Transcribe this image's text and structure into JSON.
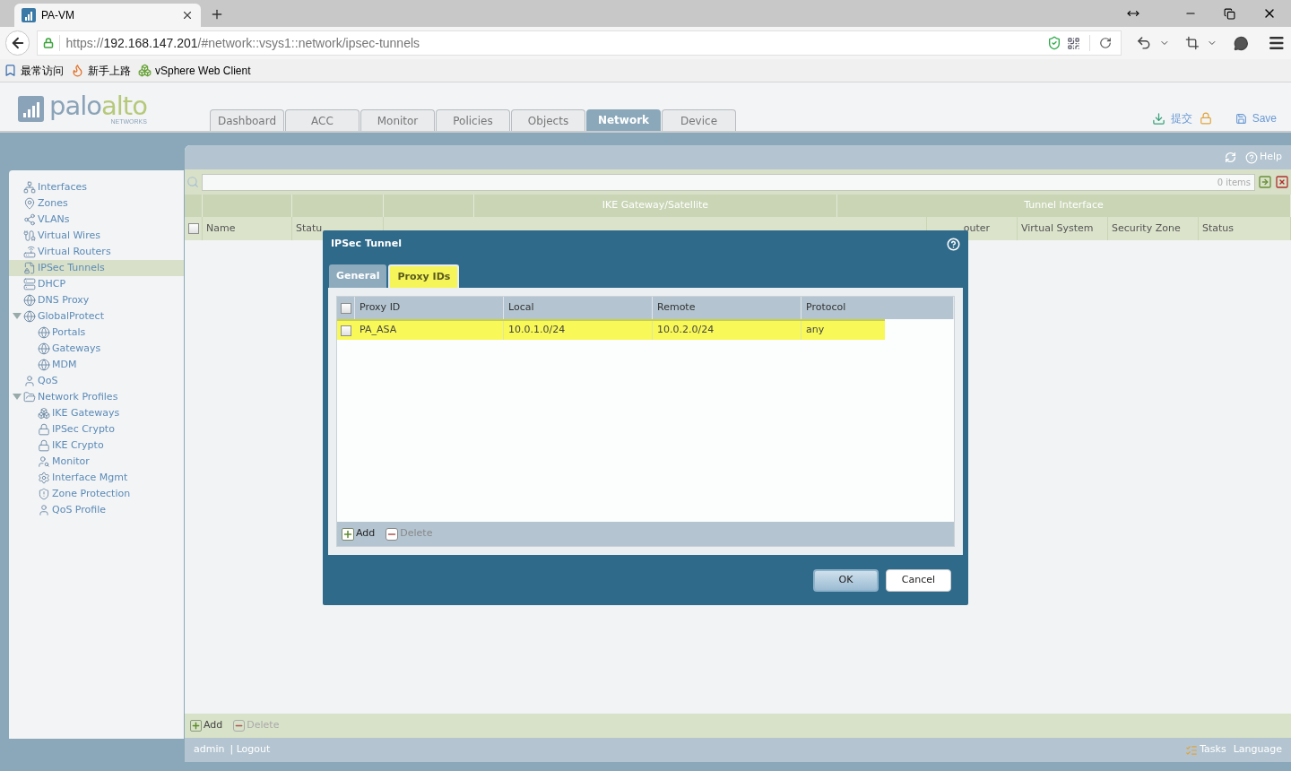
{
  "browser": {
    "tab_title": "PA-VM",
    "url_scheme": "https://",
    "url_host": "192.168.147.201",
    "url_path": "/#network::vsys1::network/ipsec-tunnels",
    "bookmarks": [
      "最常访问",
      "新手上路",
      "vSphere Web Client"
    ]
  },
  "app": {
    "logo": {
      "part1": "palo",
      "part2": "alto",
      "tagline": "NETWORKS"
    },
    "nav_tabs": [
      {
        "label": "Dashboard",
        "selected": false
      },
      {
        "label": "ACC",
        "selected": false
      },
      {
        "label": "Monitor",
        "selected": false
      },
      {
        "label": "Policies",
        "selected": false
      },
      {
        "label": "Objects",
        "selected": false
      },
      {
        "label": "Network",
        "selected": true
      },
      {
        "label": "Device",
        "selected": false
      }
    ],
    "commit": "提交",
    "save": "Save"
  },
  "sidebar": {
    "items": [
      {
        "label": "Interfaces",
        "selected": false
      },
      {
        "label": "Zones",
        "selected": false
      },
      {
        "label": "VLANs",
        "selected": false
      },
      {
        "label": "Virtual Wires",
        "selected": false
      },
      {
        "label": "Virtual Routers",
        "selected": false
      },
      {
        "label": "IPSec Tunnels",
        "selected": true
      },
      {
        "label": "DHCP",
        "selected": false
      },
      {
        "label": "DNS Proxy",
        "selected": false
      },
      {
        "label": "GlobalProtect",
        "selected": false,
        "expanded": true,
        "children": [
          {
            "label": "Portals",
            "selected": false
          },
          {
            "label": "Gateways",
            "selected": false
          },
          {
            "label": "MDM",
            "selected": false
          }
        ]
      },
      {
        "label": "QoS",
        "selected": false
      },
      {
        "label": "Network Profiles",
        "selected": false,
        "expanded": true,
        "children": [
          {
            "label": "IKE Gateways",
            "selected": false
          },
          {
            "label": "IPSec Crypto",
            "selected": false
          },
          {
            "label": "IKE Crypto",
            "selected": false
          },
          {
            "label": "Monitor",
            "selected": false
          },
          {
            "label": "Interface Mgmt",
            "selected": false
          },
          {
            "label": "Zone Protection",
            "selected": false
          },
          {
            "label": "QoS Profile",
            "selected": false
          }
        ]
      }
    ]
  },
  "toolbar": {
    "help": "Help",
    "item_count": "0 items"
  },
  "table": {
    "group_headers": [
      {
        "label": "IKE Gateway/Satellite"
      },
      {
        "label": "Tunnel Interface"
      }
    ],
    "select_all_checked": false,
    "columns": [
      "Name",
      "Statu",
      "outer",
      "Virtual System",
      "Security Zone",
      "Status"
    ],
    "footer_actions": [
      {
        "label": "Add",
        "disabled": false
      },
      {
        "label": "Delete",
        "disabled": true
      }
    ]
  },
  "status_bar": {
    "user": "admin",
    "logout": "| Logout",
    "tasks": "Tasks",
    "language": "Language"
  },
  "dialog": {
    "title": "IPSec Tunnel",
    "tabs": [
      {
        "label": "General",
        "selected": false
      },
      {
        "label": "Proxy IDs",
        "selected": true
      }
    ],
    "select_all_checked": false,
    "columns": [
      "Proxy ID",
      "Local",
      "Remote",
      "Protocol"
    ],
    "rows": [
      {
        "checked": false,
        "highlighted": true,
        "cells": [
          "PA_ASA",
          "10.0.1.0/24",
          "10.0.2.0/24",
          "any"
        ]
      }
    ],
    "actions": [
      {
        "label": "Add",
        "disabled": false
      },
      {
        "label": "Delete",
        "disabled": true
      }
    ],
    "buttons": [
      {
        "label": "OK",
        "kind": "primary"
      },
      {
        "label": "Cancel",
        "kind": "secondary"
      }
    ]
  }
}
